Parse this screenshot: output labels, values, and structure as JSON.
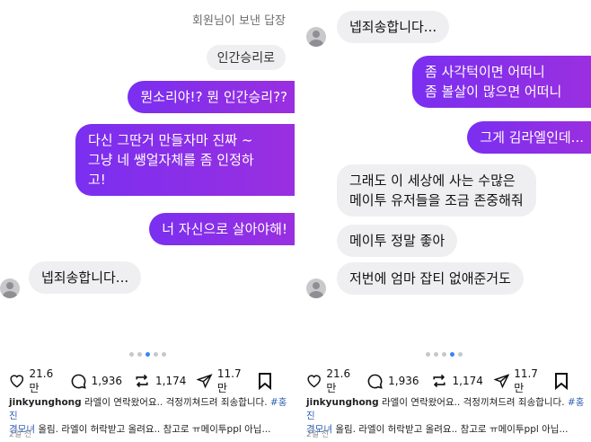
{
  "left": {
    "reply_caption": "회원님이 보낸 답장",
    "reply_text": "인간승리로",
    "messages": [
      "뭔소리야!? 뭔 인간승리??",
      "다신 그딴거 만들자마 진짜 ~\n그냥 네 쌩얼자체를 좀 인정하\n고!",
      "너 자신으로 살아야해!",
      "넵죄송합니다..."
    ],
    "stats": {
      "likes": "21.6만",
      "comments": "1,936",
      "reposts": "1,174",
      "shares": "11.7만"
    },
    "caption": {
      "user": "jinkyunghong",
      "line1": " 라엘이 연락왔어요.. 걱정끼쳐드려 죄송합니다. ",
      "tag": "#홍진\n경모녀",
      "line2": " 올림. 라엘이 허락받고 올려요.. 참고로 ㅠ메이투ppl 아닙..."
    },
    "time": "2일 전"
  },
  "right": {
    "messages": [
      "넵죄송합니다...",
      "좀 사각턱이면 어떠니\n좀 볼살이 많으면 어떠니",
      "그게 김라엘인데...",
      "그래도 이 세상에 사는 수많은\n메이투 유저들을 조금 존중해줘",
      "메이투 정말 좋아",
      "저번에 엄마 잡티 없애준거도"
    ],
    "stats": {
      "likes": "21.6만",
      "comments": "1,936",
      "reposts": "1,174",
      "shares": "11.7만"
    },
    "caption": {
      "user": "jinkyunghong",
      "line1": " 라엘이 연락왔어요.. 걱정끼쳐드려 죄송합니다. ",
      "tag": "#홍진\n경모녀",
      "line2": " 올림. 라엘이 허락받고 올려요.. 참고로 ㅠ메이투ppl 아닙..."
    },
    "time": "2일 전"
  },
  "icons": [
    "heart-icon",
    "comment-icon",
    "repost-icon",
    "share-icon",
    "bookmark-icon",
    "avatar-icon"
  ],
  "colors": {
    "purple_bubble": "#8b2ee6",
    "gray_bubble": "#efeff1",
    "dot_active": "#3b82f6",
    "hashtag": "#2f5fb3"
  }
}
